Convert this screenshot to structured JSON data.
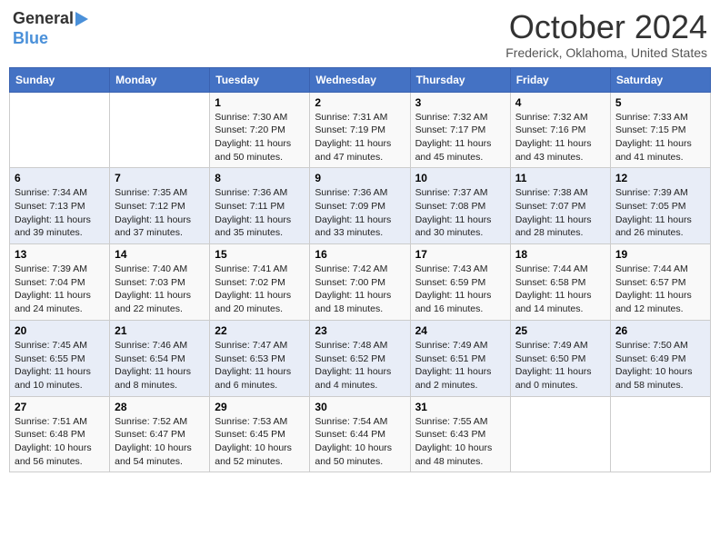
{
  "logo": {
    "line1": "General",
    "line2": "Blue"
  },
  "title": "October 2024",
  "subtitle": "Frederick, Oklahoma, United States",
  "days_of_week": [
    "Sunday",
    "Monday",
    "Tuesday",
    "Wednesday",
    "Thursday",
    "Friday",
    "Saturday"
  ],
  "weeks": [
    [
      {
        "day": "",
        "info": ""
      },
      {
        "day": "",
        "info": ""
      },
      {
        "day": "1",
        "info": "Sunrise: 7:30 AM\nSunset: 7:20 PM\nDaylight: 11 hours and 50 minutes."
      },
      {
        "day": "2",
        "info": "Sunrise: 7:31 AM\nSunset: 7:19 PM\nDaylight: 11 hours and 47 minutes."
      },
      {
        "day": "3",
        "info": "Sunrise: 7:32 AM\nSunset: 7:17 PM\nDaylight: 11 hours and 45 minutes."
      },
      {
        "day": "4",
        "info": "Sunrise: 7:32 AM\nSunset: 7:16 PM\nDaylight: 11 hours and 43 minutes."
      },
      {
        "day": "5",
        "info": "Sunrise: 7:33 AM\nSunset: 7:15 PM\nDaylight: 11 hours and 41 minutes."
      }
    ],
    [
      {
        "day": "6",
        "info": "Sunrise: 7:34 AM\nSunset: 7:13 PM\nDaylight: 11 hours and 39 minutes."
      },
      {
        "day": "7",
        "info": "Sunrise: 7:35 AM\nSunset: 7:12 PM\nDaylight: 11 hours and 37 minutes."
      },
      {
        "day": "8",
        "info": "Sunrise: 7:36 AM\nSunset: 7:11 PM\nDaylight: 11 hours and 35 minutes."
      },
      {
        "day": "9",
        "info": "Sunrise: 7:36 AM\nSunset: 7:09 PM\nDaylight: 11 hours and 33 minutes."
      },
      {
        "day": "10",
        "info": "Sunrise: 7:37 AM\nSunset: 7:08 PM\nDaylight: 11 hours and 30 minutes."
      },
      {
        "day": "11",
        "info": "Sunrise: 7:38 AM\nSunset: 7:07 PM\nDaylight: 11 hours and 28 minutes."
      },
      {
        "day": "12",
        "info": "Sunrise: 7:39 AM\nSunset: 7:05 PM\nDaylight: 11 hours and 26 minutes."
      }
    ],
    [
      {
        "day": "13",
        "info": "Sunrise: 7:39 AM\nSunset: 7:04 PM\nDaylight: 11 hours and 24 minutes."
      },
      {
        "day": "14",
        "info": "Sunrise: 7:40 AM\nSunset: 7:03 PM\nDaylight: 11 hours and 22 minutes."
      },
      {
        "day": "15",
        "info": "Sunrise: 7:41 AM\nSunset: 7:02 PM\nDaylight: 11 hours and 20 minutes."
      },
      {
        "day": "16",
        "info": "Sunrise: 7:42 AM\nSunset: 7:00 PM\nDaylight: 11 hours and 18 minutes."
      },
      {
        "day": "17",
        "info": "Sunrise: 7:43 AM\nSunset: 6:59 PM\nDaylight: 11 hours and 16 minutes."
      },
      {
        "day": "18",
        "info": "Sunrise: 7:44 AM\nSunset: 6:58 PM\nDaylight: 11 hours and 14 minutes."
      },
      {
        "day": "19",
        "info": "Sunrise: 7:44 AM\nSunset: 6:57 PM\nDaylight: 11 hours and 12 minutes."
      }
    ],
    [
      {
        "day": "20",
        "info": "Sunrise: 7:45 AM\nSunset: 6:55 PM\nDaylight: 11 hours and 10 minutes."
      },
      {
        "day": "21",
        "info": "Sunrise: 7:46 AM\nSunset: 6:54 PM\nDaylight: 11 hours and 8 minutes."
      },
      {
        "day": "22",
        "info": "Sunrise: 7:47 AM\nSunset: 6:53 PM\nDaylight: 11 hours and 6 minutes."
      },
      {
        "day": "23",
        "info": "Sunrise: 7:48 AM\nSunset: 6:52 PM\nDaylight: 11 hours and 4 minutes."
      },
      {
        "day": "24",
        "info": "Sunrise: 7:49 AM\nSunset: 6:51 PM\nDaylight: 11 hours and 2 minutes."
      },
      {
        "day": "25",
        "info": "Sunrise: 7:49 AM\nSunset: 6:50 PM\nDaylight: 11 hours and 0 minutes."
      },
      {
        "day": "26",
        "info": "Sunrise: 7:50 AM\nSunset: 6:49 PM\nDaylight: 10 hours and 58 minutes."
      }
    ],
    [
      {
        "day": "27",
        "info": "Sunrise: 7:51 AM\nSunset: 6:48 PM\nDaylight: 10 hours and 56 minutes."
      },
      {
        "day": "28",
        "info": "Sunrise: 7:52 AM\nSunset: 6:47 PM\nDaylight: 10 hours and 54 minutes."
      },
      {
        "day": "29",
        "info": "Sunrise: 7:53 AM\nSunset: 6:45 PM\nDaylight: 10 hours and 52 minutes."
      },
      {
        "day": "30",
        "info": "Sunrise: 7:54 AM\nSunset: 6:44 PM\nDaylight: 10 hours and 50 minutes."
      },
      {
        "day": "31",
        "info": "Sunrise: 7:55 AM\nSunset: 6:43 PM\nDaylight: 10 hours and 48 minutes."
      },
      {
        "day": "",
        "info": ""
      },
      {
        "day": "",
        "info": ""
      }
    ]
  ]
}
